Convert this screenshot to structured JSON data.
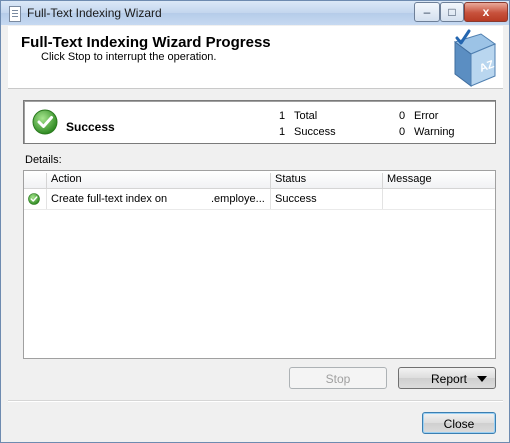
{
  "window": {
    "title": "Full-Text Indexing Wizard",
    "caption_min": "–",
    "caption_max": "□",
    "caption_close": "x"
  },
  "header": {
    "title": "Full-Text Indexing Wizard Progress",
    "subtitle": "Click Stop to interrupt the operation."
  },
  "summary": {
    "status": "Success",
    "total_count": "1",
    "total_label": "Total",
    "success_count": "1",
    "success_label": "Success",
    "error_count": "0",
    "error_label": "Error",
    "warning_count": "0",
    "warning_label": "Warning"
  },
  "details": {
    "label": "Details:",
    "columns": [
      "Action",
      "Status",
      "Message"
    ],
    "rows": [
      {
        "action": "Create full-text index on",
        "object": ".employe...",
        "status": "Success",
        "message": ""
      }
    ]
  },
  "buttons": {
    "stop": "Stop",
    "report": "Report",
    "close": "Close"
  },
  "icons": {
    "title": "document-icon",
    "header": "book-az-icon",
    "status": "success-check-icon"
  },
  "colors": {
    "success_green": "#3aa22d",
    "title_bar": "#c3d6ee"
  }
}
